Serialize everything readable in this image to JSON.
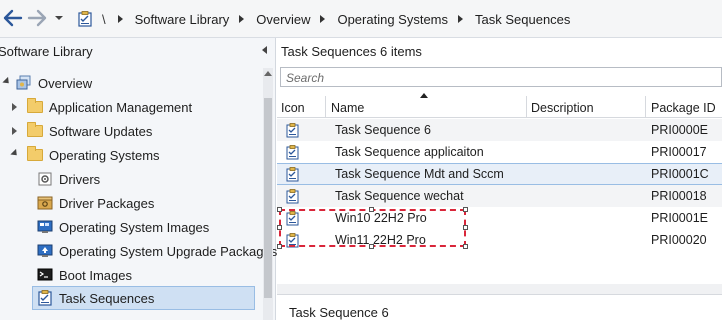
{
  "toolbar": {
    "back_icon": "back-arrow-icon",
    "forward_icon": "forward-arrow-icon",
    "dropdown_icon": "chevron-down-icon"
  },
  "breadcrumb": {
    "root": "\\",
    "items": [
      "Software Library",
      "Overview",
      "Operating Systems",
      "Task Sequences"
    ]
  },
  "sidebar": {
    "title": "Software Library",
    "items": [
      {
        "label": "Overview",
        "icon": "overview-icon"
      },
      {
        "label": "Application Management",
        "icon": "folder-icon"
      },
      {
        "label": "Software Updates",
        "icon": "folder-icon"
      },
      {
        "label": "Operating Systems",
        "icon": "folder-icon"
      },
      {
        "label": "Drivers",
        "icon": "drivers-icon"
      },
      {
        "label": "Driver Packages",
        "icon": "driver-packages-icon"
      },
      {
        "label": "Operating System Images",
        "icon": "os-images-icon"
      },
      {
        "label": "Operating System Upgrade Packages",
        "icon": "os-upgrade-icon"
      },
      {
        "label": "Boot Images",
        "icon": "boot-images-icon"
      },
      {
        "label": "Task Sequences",
        "icon": "task-sequences-icon"
      }
    ]
  },
  "main": {
    "title": "Task Sequences 6 items",
    "search_placeholder": "Search",
    "columns": [
      "Icon",
      "Name",
      "Description",
      "Package ID"
    ],
    "rows": [
      {
        "name": "Task Sequence 6",
        "description": "",
        "package_id": "PRI0000E"
      },
      {
        "name": "Task Sequence applicaiton",
        "description": "",
        "package_id": "PRI00017"
      },
      {
        "name": "Task Sequence Mdt and Sccm",
        "description": "",
        "package_id": "PRI0001C"
      },
      {
        "name": "Task Sequence wechat",
        "description": "",
        "package_id": "PRI00018"
      },
      {
        "name": "Win10 22H2 Pro",
        "description": "",
        "package_id": "PRI0001E"
      },
      {
        "name": "Win11 22H2 Pro",
        "description": "",
        "package_id": "PRI00020"
      }
    ],
    "detail_title": "Task Sequence 6"
  },
  "colors": {
    "selection": "#cfe0f3",
    "highlight_border": "#d9263a",
    "pane_background": "#f4f6f9"
  }
}
